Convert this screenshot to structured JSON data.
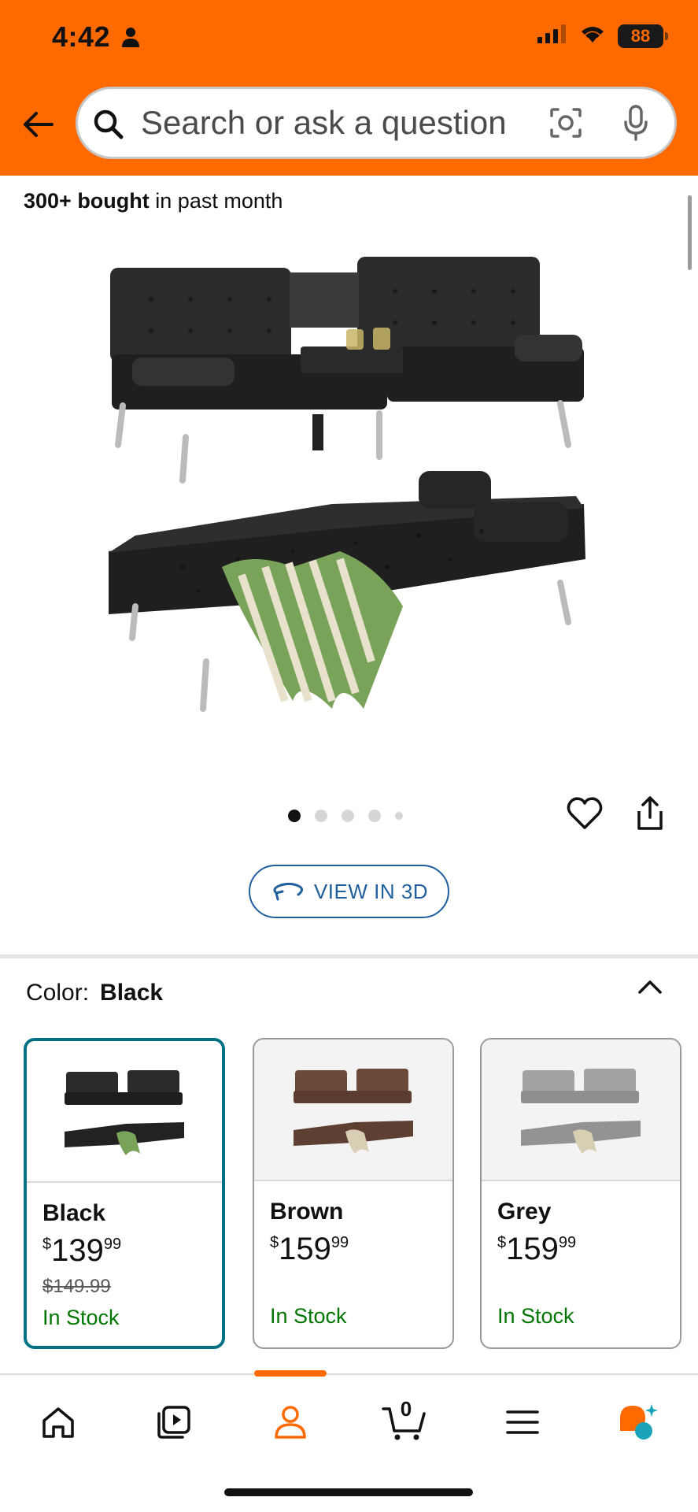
{
  "status_bar": {
    "time": "4:42",
    "battery": "88",
    "icons": [
      "person-icon",
      "cellular-signal-icon",
      "wifi-icon",
      "battery-icon"
    ]
  },
  "header": {
    "back_icon": "back-arrow-icon",
    "search": {
      "placeholder": "Search or ask a question",
      "icons": [
        "search-icon",
        "camera-icon",
        "microphone-icon"
      ]
    },
    "color": "#ff6a00"
  },
  "product": {
    "bought_bold": "300+ bought",
    "bought_rest": " in past month",
    "image_count": 5,
    "active_image": 1,
    "actions": [
      "heart-icon",
      "share-icon"
    ],
    "view3d_label": "VIEW IN 3D",
    "view3d_icon": "rotate-3d-icon"
  },
  "color_selector": {
    "label": "Color:",
    "selected": "Black",
    "collapse_icon": "chevron-up-icon",
    "options": [
      {
        "name": "Black",
        "currency": "$",
        "price_whole": "139",
        "price_cents": "99",
        "was": "$149.99",
        "stock": "In Stock",
        "swatch": "#2a2a2a",
        "selected": true
      },
      {
        "name": "Brown",
        "currency": "$",
        "price_whole": "159",
        "price_cents": "99",
        "was": "",
        "stock": "In Stock",
        "swatch": "#6b4a3a",
        "selected": false
      },
      {
        "name": "Grey",
        "currency": "$",
        "price_whole": "159",
        "price_cents": "99",
        "was": "",
        "stock": "In Stock",
        "swatch": "#9a9a9a",
        "selected": false
      }
    ]
  },
  "bottom_nav": {
    "items": [
      "home-icon",
      "video-icon",
      "account-icon",
      "cart-icon",
      "menu-icon",
      "rufus-icon"
    ],
    "active": "account-icon",
    "cart_count": "0",
    "accent": "#ff6a00"
  },
  "colors": {
    "link": "#1f5f9d",
    "selected_border": "#007185",
    "in_stock": "#007600"
  }
}
